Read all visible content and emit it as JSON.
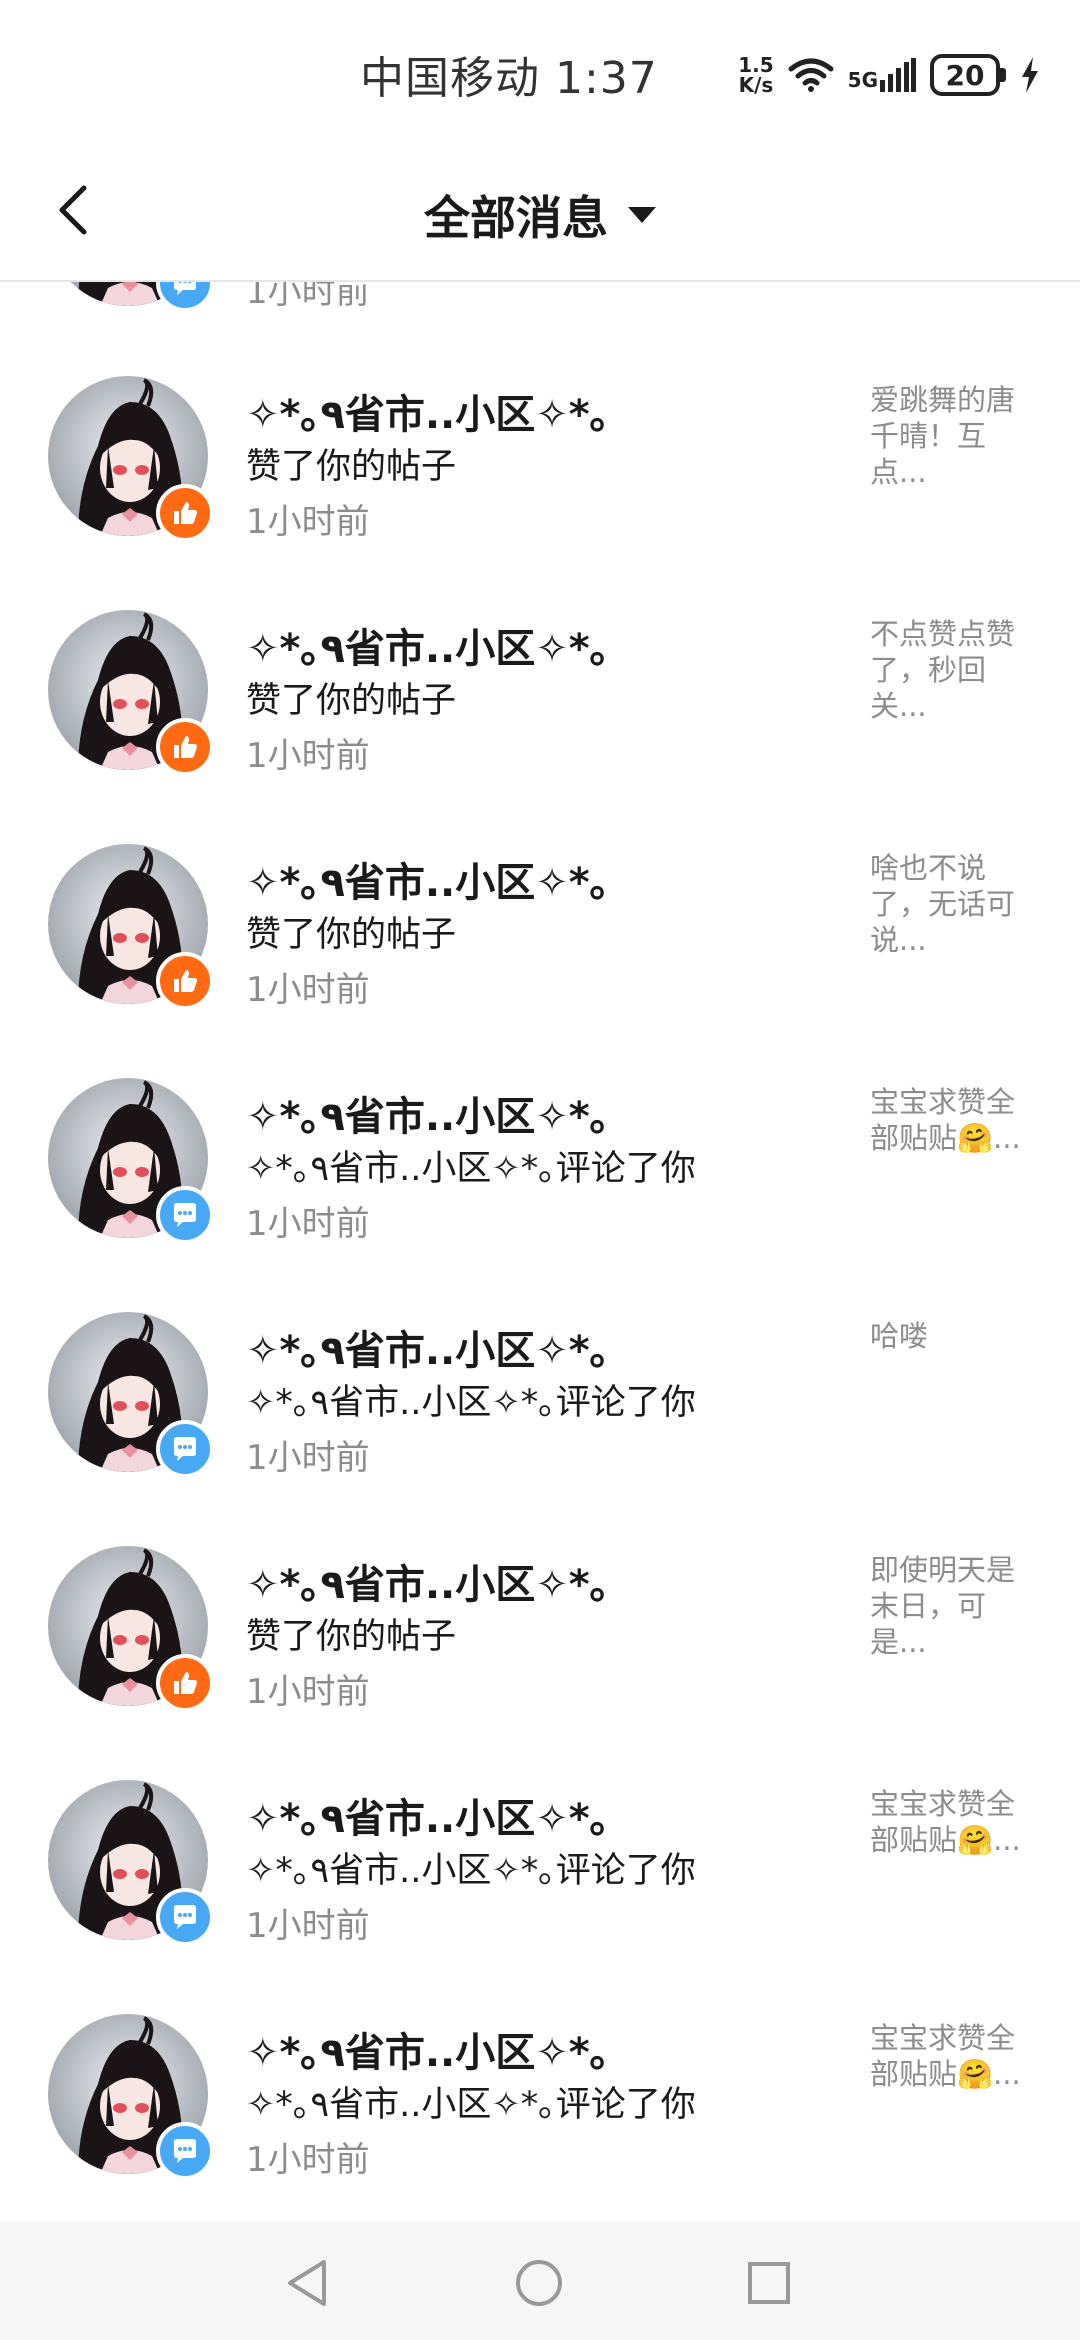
{
  "status_bar": {
    "carrier_time": "中国移动 1:37",
    "net_speed_value": "1.5",
    "net_speed_unit": "K/s",
    "network": "5G",
    "battery": "20",
    "icons": [
      "wifi-icon",
      "signal-icon",
      "battery-icon",
      "charging-icon"
    ]
  },
  "navbar": {
    "title": "全部消息",
    "back_icon": "chevron-left-icon",
    "dropdown_icon": "caret-down-icon"
  },
  "partial_top": {
    "time": "1小时前"
  },
  "items": [
    {
      "name": "✧*｡٩省市..小区✧*｡",
      "action": "赞了你的帖子",
      "time": "1小时前",
      "preview": "爱跳舞的唐千晴！互点...",
      "badge": "like"
    },
    {
      "name": "✧*｡٩省市..小区✧*｡",
      "action": "赞了你的帖子",
      "time": "1小时前",
      "preview": "不点赞点赞了，秒回关...",
      "badge": "like"
    },
    {
      "name": "✧*｡٩省市..小区✧*｡",
      "action": "赞了你的帖子",
      "time": "1小时前",
      "preview": "啥也不说了，无话可说...",
      "badge": "like"
    },
    {
      "name": "✧*｡٩省市..小区✧*｡",
      "action": "✧*｡٩省市..小区✧*｡评论了你",
      "time": "1小时前",
      "preview": "宝宝求赞全部贴贴🤗...",
      "badge": "comment"
    },
    {
      "name": "✧*｡٩省市..小区✧*｡",
      "action": "✧*｡٩省市..小区✧*｡评论了你",
      "time": "1小时前",
      "preview": "哈喽",
      "badge": "comment"
    },
    {
      "name": "✧*｡٩省市..小区✧*｡",
      "action": "赞了你的帖子",
      "time": "1小时前",
      "preview": "即使明天是末日，可是...",
      "badge": "like"
    },
    {
      "name": "✧*｡٩省市..小区✧*｡",
      "action": "✧*｡٩省市..小区✧*｡评论了你",
      "time": "1小时前",
      "preview": "宝宝求赞全部贴贴🤗...",
      "badge": "comment"
    },
    {
      "name": "✧*｡٩省市..小区✧*｡",
      "action": "✧*｡٩省市..小区✧*｡评论了你",
      "time": "1小时前",
      "preview": "宝宝求赞全部贴贴🤗...",
      "badge": "comment"
    }
  ],
  "system_nav": [
    "back-triangle-icon",
    "home-circle-icon",
    "recents-square-icon"
  ],
  "colors": {
    "like_badge": "#ff6a13",
    "comment_badge": "#47a8f5",
    "secondary_text": "#8c8c8c"
  }
}
